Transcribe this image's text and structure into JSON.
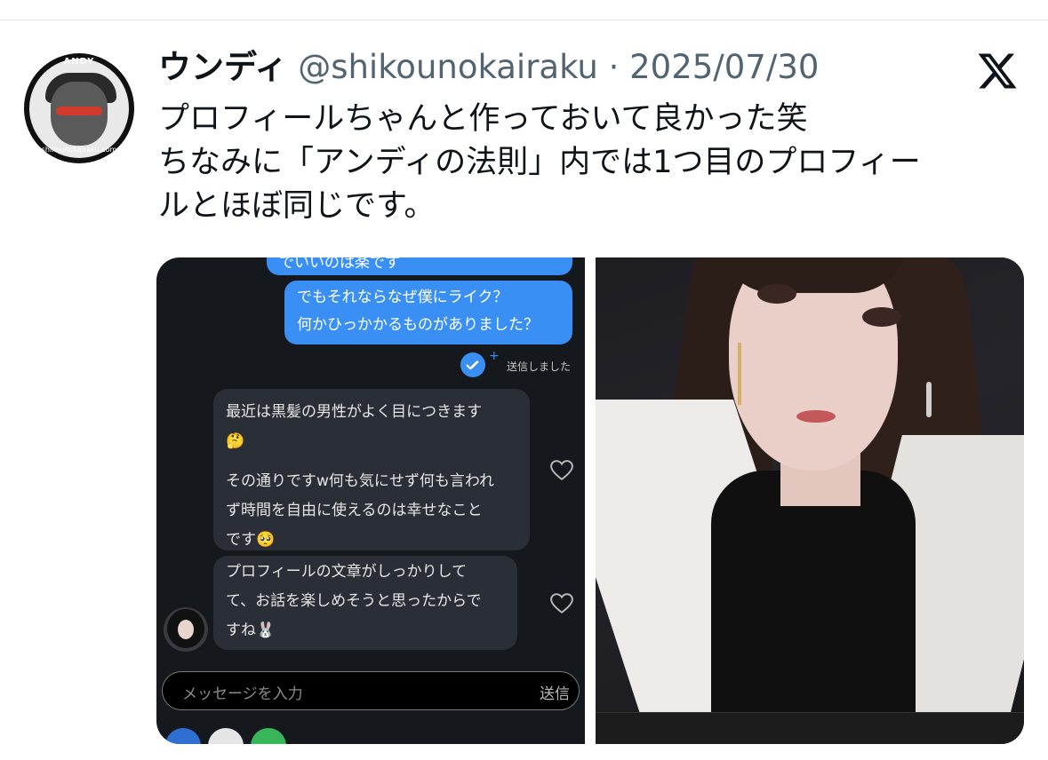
{
  "tweet": {
    "author_name": "ウンディ",
    "author_handle": "@shikounokairaku",
    "separator": "·",
    "date": "2025/07/30",
    "avatar": {
      "top_text": "ANDY",
      "bottom_text": "shikounokairaku.com"
    },
    "text_lines": [
      "プロフィールちゃんと作っておいて良かった笑",
      "ちなみに「アンディの法則」内では1つ目のプロフィー",
      "ルとほぼ同じです。"
    ]
  },
  "chat_screenshot": {
    "outgoing_partial": "でいいのは楽です",
    "outgoing_message": [
      "でもそれならなぜ僕にライク？",
      "何かひっかかるものがありました？"
    ],
    "sent_status": "送信しました",
    "incoming_1": {
      "line1": "最近は黒髪の男性がよく目につきます",
      "emoji1": "🤔",
      "line2": "その通りですw何も気にせず何も言われ",
      "line3": "ず時間を自由に使えるのは幸せなこと",
      "line4": "です🥺"
    },
    "incoming_2": {
      "line1": "プロフィールの文章がしっかりして",
      "line2": "て、お話を楽しめそうと思ったからで",
      "line3": "すね🐰"
    },
    "input_placeholder": "メッセージを入力",
    "send_label": "送信"
  },
  "colors": {
    "outgoing_bubble": "#3a8ff5",
    "chat_background": "#15181d",
    "incoming_bubble": "#2a2e36",
    "handle_gray": "#536471"
  }
}
